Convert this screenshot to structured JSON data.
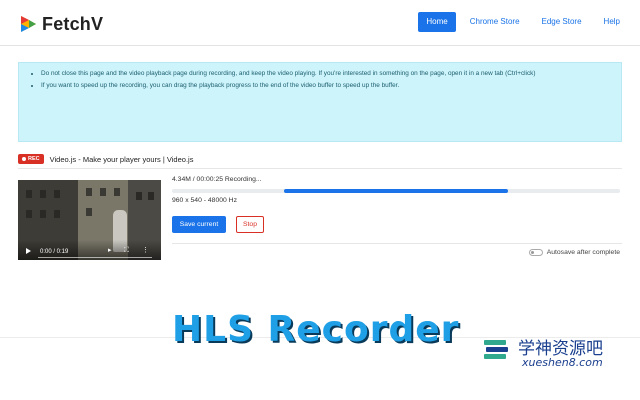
{
  "header": {
    "app_name": "FetchV",
    "nav": [
      {
        "label": "Home",
        "active": true
      },
      {
        "label": "Chrome Store",
        "active": false
      },
      {
        "label": "Edge Store",
        "active": false
      },
      {
        "label": "Help",
        "active": false
      }
    ]
  },
  "alert": {
    "items": [
      "Do not close this page and the video playback page during recording, and keep the video playing. If you're interested in something on the page, open it in a new tab (Ctrl+click)",
      "If you want to speed up the recording, you can drag the playback progress to the end of the video buffer to speed up the buffer."
    ]
  },
  "tab": {
    "badge": "REC",
    "title": "Video.js - Make your player yours | Video.js"
  },
  "video": {
    "time": "0:00 / 0:19",
    "icons": [
      "play-icon",
      "volume-icon",
      "fullscreen-icon",
      "more-icon"
    ]
  },
  "recording": {
    "status": "4.34M / 00:00:25   Recording...",
    "progress_start": 0.25,
    "progress_end": 0.75,
    "resolution": "960 x 540 - 48000 Hz",
    "save_label": "Save current",
    "stop_label": "Stop",
    "autosave_label": "Autosave after complete",
    "autosave_on": false
  },
  "promo": {
    "text": "HLS Recorder"
  },
  "watermark": {
    "cn": "学神资源吧",
    "en": "xueshen8.com"
  },
  "colors": {
    "accent": "#1a73e8",
    "alert_bg": "#cdf3fb",
    "danger": "#d93025",
    "promo": "#1e9fe6"
  }
}
